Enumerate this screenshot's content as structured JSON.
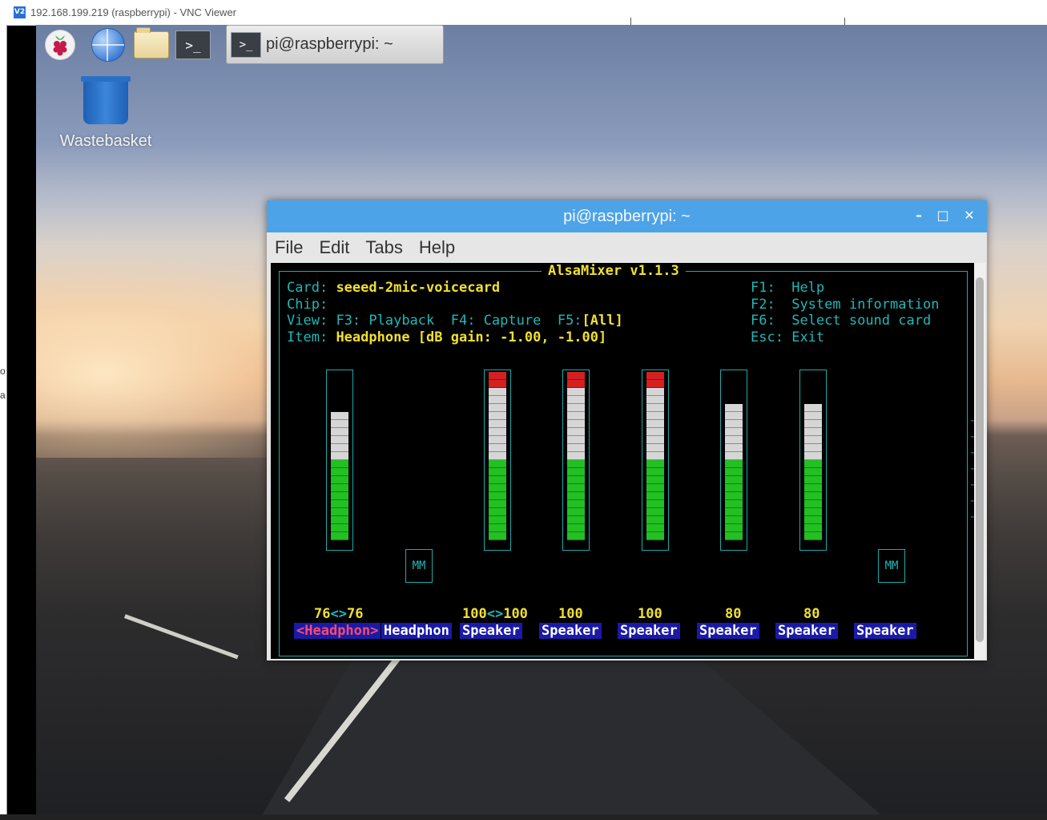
{
  "vnc": {
    "title": "192.168.199.219 (raspberrypi) - VNC Viewer",
    "icon_text": "V2"
  },
  "left_strip_chars": [
    "o",
    "a"
  ],
  "panel": {
    "icons": [
      "raspberry-pi-menu-icon",
      "web-browser-globe-icon",
      "file-manager-folder-icon",
      "terminal-icon"
    ],
    "taskbar_task": "pi@raspberrypi: ~",
    "terminal_glyph": ">_"
  },
  "desktop": {
    "wastebasket_label": "Wastebasket"
  },
  "terminal": {
    "title": "pi@raspberrypi: ~",
    "controls": {
      "minimize": "–",
      "maximize": "□",
      "close": "✕"
    },
    "menu": [
      "File",
      "Edit",
      "Tabs",
      "Help"
    ]
  },
  "alsamixer": {
    "title": "AlsaMixer v1.1.3",
    "card_label": "Card:",
    "card_value": "seeed-2mic-voicecard",
    "chip_label": "Chip:",
    "view_label": "View:",
    "view_f3": "F3: Playback",
    "view_f4": "F4: Capture",
    "view_f5_key": "F5:",
    "view_f5_value": "[All]",
    "item_label": "Item:",
    "item_value": "Headphone [dB gain: -1.00, -1.00]",
    "help": [
      {
        "key": "F1:",
        "text": "Help"
      },
      {
        "key": "F2:",
        "text": "System information"
      },
      {
        "key": "F6:",
        "text": "Select sound card"
      },
      {
        "key": "Esc:",
        "text": "Exit"
      }
    ],
    "mm_label": "MM",
    "channels": [
      {
        "name": "Headphon",
        "value_left": "76",
        "sep": "<>",
        "value_right": "76",
        "selected": true,
        "level": 76
      },
      {
        "name": "Headphon",
        "value_left": "",
        "sep": "",
        "value_right": "",
        "selected": false,
        "level": null
      },
      {
        "name": "Speaker",
        "value_left": "100",
        "sep": "<>",
        "value_right": "100",
        "selected": false,
        "level": 100
      },
      {
        "name": "Speaker",
        "value_left": "100",
        "sep": "",
        "value_right": "",
        "selected": false,
        "level": 100
      },
      {
        "name": "Speaker",
        "value_left": "100",
        "sep": "",
        "value_right": "",
        "selected": false,
        "level": 100
      },
      {
        "name": "Speaker",
        "value_left": "80",
        "sep": "",
        "value_right": "",
        "selected": false,
        "level": 80
      },
      {
        "name": "Speaker",
        "value_left": "80",
        "sep": "",
        "value_right": "",
        "selected": false,
        "level": 80
      },
      {
        "name": "Speaker",
        "value_left": "",
        "sep": "",
        "value_right": "",
        "selected": false,
        "level": null
      }
    ],
    "selected_open": "<",
    "selected_close": ">"
  },
  "colors": {
    "title_blue": "#4da3e8",
    "term_cyan": "#20b8b8",
    "term_yellow": "#f0e030",
    "meter_green": "#22c022",
    "meter_white": "#d6d6d6",
    "meter_red": "#d42020",
    "name_bg": "#1a1aa8",
    "selected_pink": "#ff4a6a"
  }
}
